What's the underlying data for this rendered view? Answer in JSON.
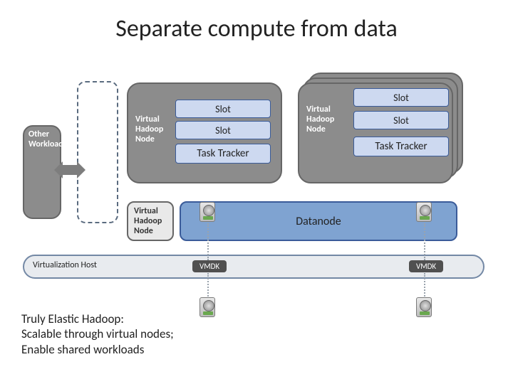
{
  "title": "Separate compute from data",
  "labels": {
    "virtual_hadoop_node": "Virtual Hadoop Node",
    "slot": "Slot",
    "task_tracker": "Task Tracker",
    "datanode": "Datanode",
    "other_workload": "Other Workload",
    "virtualization_host": "Virtualization Host",
    "vmdk": "VMDK"
  },
  "blurb": {
    "l1": "Truly Elastic Hadoop:",
    "l2": "Scalable through virtual nodes;",
    "l3": "Enable shared workloads"
  },
  "colors": {
    "node_grey": "#8c8c8c",
    "panel_blue": "#cdd9f0",
    "accent_blue": "#7fa3d1",
    "border_blue": "#3a5b99"
  }
}
